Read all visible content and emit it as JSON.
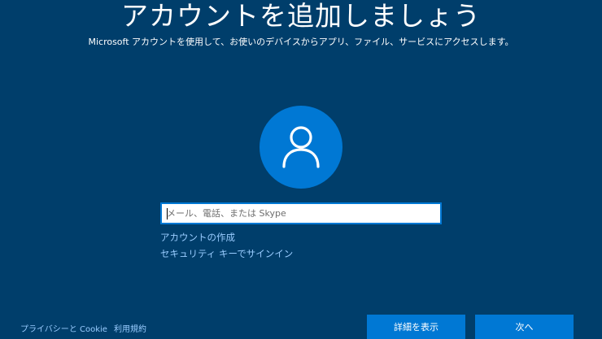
{
  "header": {
    "title": "アカウントを追加しましょう",
    "subtitle": "Microsoft アカウントを使用して、お使いのデバイスからアプリ、ファイル、サービスにアクセスします。"
  },
  "avatar": {
    "icon": "user-icon",
    "color": "#0078D4"
  },
  "form": {
    "email_value": "",
    "email_placeholder": "メール、電話、または Skype",
    "create_account_label": "アカウントの作成",
    "security_key_label": "セキュリティ キーでサインイン"
  },
  "footer": {
    "privacy_label": "プライバシーと Cookie",
    "terms_label": "利用規約",
    "details_button": "詳細を表示",
    "next_button": "次へ"
  },
  "colors": {
    "background": "#003E6B",
    "accent": "#0078D4",
    "link": "#99CCFF"
  }
}
